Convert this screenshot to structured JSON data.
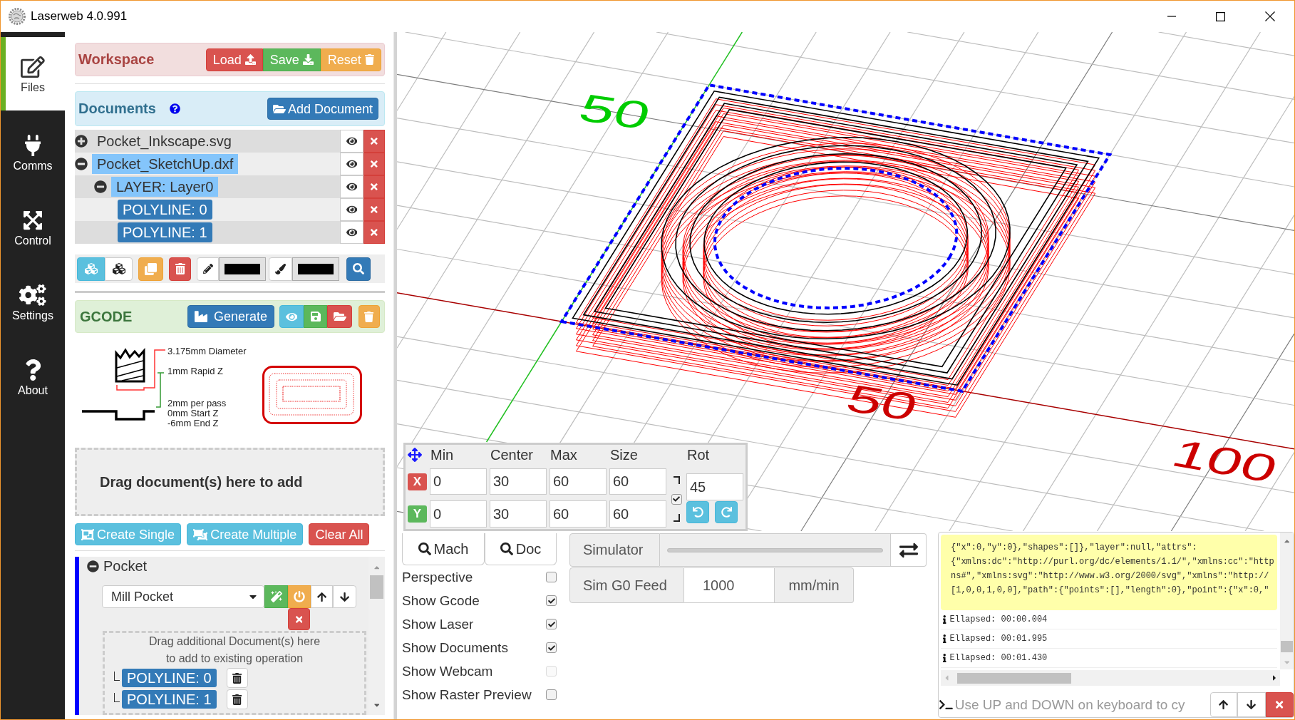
{
  "window": {
    "title": "Laserweb 4.0.991"
  },
  "nav": [
    {
      "label": "Files",
      "selected": true
    },
    {
      "label": "Comms",
      "selected": false
    },
    {
      "label": "Control",
      "selected": false
    },
    {
      "label": "Settings",
      "selected": false
    },
    {
      "label": "About",
      "selected": false
    }
  ],
  "workspace": {
    "title": "Workspace",
    "buttons": [
      {
        "label": "Load",
        "kind": "load"
      },
      {
        "label": "Save",
        "kind": "save"
      },
      {
        "label": "Reset",
        "kind": "reset"
      }
    ]
  },
  "documents": {
    "title": "Documents",
    "add_button": "Add Document",
    "tree": [
      {
        "label": "Pocket_Inkscape.svg",
        "expanded": false,
        "selected": false
      },
      {
        "label": "Pocket_SketchUp.dxf",
        "expanded": true,
        "selected": true,
        "children": [
          {
            "label": "LAYER: Layer0",
            "expanded": true,
            "selected": true,
            "children": [
              {
                "label": "POLYLINE: 0",
                "selected": true
              },
              {
                "label": "POLYLINE: 1",
                "selected": true
              }
            ]
          }
        ]
      }
    ]
  },
  "doc_toolbar": {
    "swatches": [
      {
        "kind": "stroke",
        "color": "#000000"
      },
      {
        "kind": "fill",
        "color": "#000000"
      }
    ]
  },
  "gcode": {
    "title": "GCODE",
    "generate_button": "Generate",
    "diagram": {
      "diameter": "3.175mm Diameter",
      "rapid_z": "1mm Rapid Z",
      "pass_depth": "2mm per pass",
      "start_z": "0mm Start Z",
      "end_z": "-6mm End Z"
    }
  },
  "drop_zone": {
    "text": "Drag document(s) here to add"
  },
  "create_buttons": [
    {
      "label": "Create Single",
      "kind": "single"
    },
    {
      "label": "Create Multiple",
      "kind": "multiple"
    },
    {
      "label": "Clear All",
      "kind": "clear"
    }
  ],
  "operations": [
    {
      "title": "Pocket",
      "expanded": true,
      "type": "Mill Pocket",
      "drop_hint": [
        "Drag additional Document(s) here",
        "to add to existing operation"
      ],
      "documents": [
        "POLYLINE: 0",
        "POLYLINE: 1"
      ]
    }
  ],
  "viewport": {
    "axis_labels": [
      {
        "text": "50",
        "color": "#00cc00"
      },
      {
        "text": "50",
        "color": "#cc0000"
      },
      {
        "text": "100",
        "color": "#cc0000"
      }
    ]
  },
  "bounds": {
    "columns": [
      "Min",
      "Center",
      "Max",
      "Size",
      "Rot"
    ],
    "rows": [
      {
        "axis": "X",
        "color": "#d9534f",
        "values": [
          "0",
          "30",
          "60",
          "60"
        ]
      },
      {
        "axis": "Y",
        "color": "#5cb85c",
        "values": [
          "0",
          "30",
          "60",
          "60"
        ]
      }
    ],
    "aspect_lock": {
      "checked": true
    },
    "rotation": "45"
  },
  "view_buttons": [
    "Mach",
    "Doc"
  ],
  "view_options": [
    {
      "label": "Perspective",
      "checked": false,
      "disabled": false
    },
    {
      "label": "Show Gcode",
      "checked": true,
      "disabled": false
    },
    {
      "label": "Show Laser",
      "checked": true,
      "disabled": false
    },
    {
      "label": "Show Documents",
      "checked": true,
      "disabled": false
    },
    {
      "label": "Show Webcam",
      "checked": false,
      "disabled": true
    },
    {
      "label": "Show Raster Preview",
      "checked": false,
      "disabled": false
    }
  ],
  "simulator": {
    "label": "Simulator"
  },
  "sim_feed": {
    "label": "Sim G0 Feed",
    "value": "1000",
    "unit": "mm/min"
  },
  "console": {
    "code_lines": [
      "{\"x\":0,\"y\":0},\"shapes\":[]},\"layer\":null,\"attrs\":",
      "{\"xmlns:dc\":\"http://purl.org/dc/elements/1.1/\",\"xmlns:cc\":\"http",
      "ns#\",\"xmlns:svg\":\"http://www.w3.org/2000/svg\",\"xmlns\":\"http://",
      "[1,0,0,1,0,0],\"path\":{\"points\":[],\"length\":0},\"point\":{\"x\":0,\""
    ],
    "log": [
      "Ellapsed: 00:00.004",
      "Ellapsed: 00:01.995",
      "Ellapsed: 00:01.430"
    ],
    "placeholder": "Use UP and DOWN on keyboard to cy"
  }
}
